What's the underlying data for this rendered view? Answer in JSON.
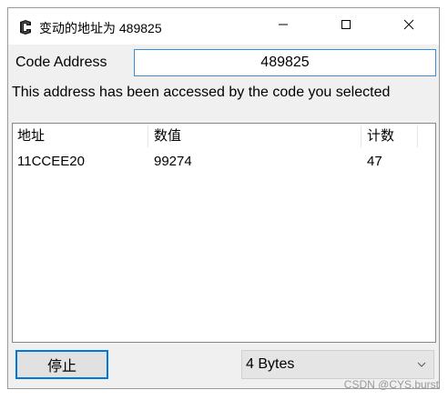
{
  "window": {
    "title": "变动的地址为 489825",
    "icon": "cheat-engine-icon",
    "minimize_icon": "minimize-icon",
    "maximize_icon": "maximize-icon",
    "close_icon": "close-icon"
  },
  "code_address": {
    "label": "Code Address",
    "value": "489825"
  },
  "message": "This address has been accessed by the code you selected",
  "list": {
    "columns": [
      "地址",
      "数值",
      "计数"
    ],
    "rows": [
      {
        "address": "11CCEE20",
        "value": "99274",
        "count": "47"
      }
    ]
  },
  "footer": {
    "stop_label": "停止",
    "size_selected": "4 Bytes"
  },
  "watermark": "CSDN @CYS.burst",
  "colors": {
    "focus_border": "#0078d7",
    "input_border": "#3c8dd6",
    "window_bg": "#f0f0f0"
  }
}
